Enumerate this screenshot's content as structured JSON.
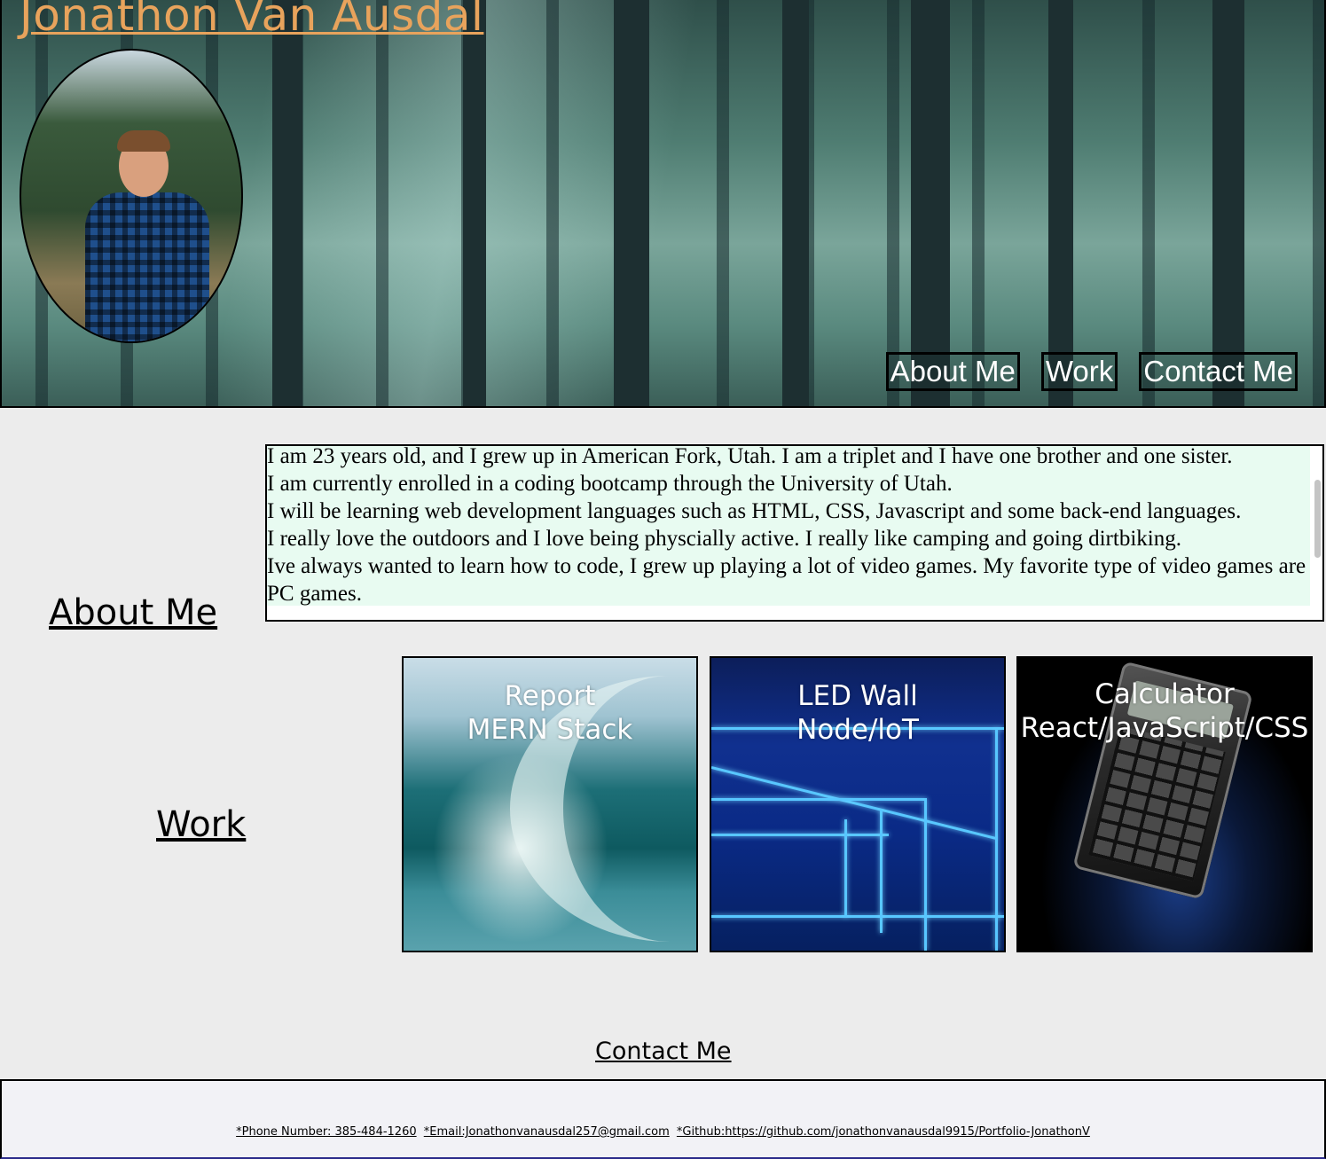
{
  "header": {
    "title": "Jonathon Van Ausdal",
    "nav": {
      "about": "About Me",
      "work": "Work",
      "contact": "Contact Me"
    }
  },
  "about": {
    "heading": "About Me",
    "paragraphs": [
      "I am 23 years old, and I grew up in American Fork, Utah. I am a triplet and I have one brother and one sister.",
      "I am currently enrolled in a coding bootcamp through the University of Utah.",
      "I will be learning web development languages such as HTML, CSS, Javascript and some back-end languages.",
      "I really love the outdoors and I love being physcially active. I really like camping and going dirtbiking.",
      "Ive always wanted to learn how to code, I grew up playing a lot of video games. My favorite type of video games are PC games."
    ]
  },
  "work": {
    "heading": "Work",
    "projects": [
      {
        "line1": "Report",
        "line2": "MERN Stack"
      },
      {
        "line1": "LED Wall",
        "line2": "Node/loT"
      },
      {
        "line1": "Calculator",
        "line2": "React/JavaScript/CSS"
      }
    ]
  },
  "contact": {
    "heading": "Contact Me",
    "phone": "*Phone Number: 385-484-1260",
    "email": "*Email:Jonathonvanausdal257@gmail.com",
    "github": "*Github:https://github.com/jonathonvanausdal9915/Portfolio-JonathonV"
  },
  "colors": {
    "title": "#e8a35c",
    "about_bg": "#e8fbf1",
    "page_bg": "#ececec"
  }
}
